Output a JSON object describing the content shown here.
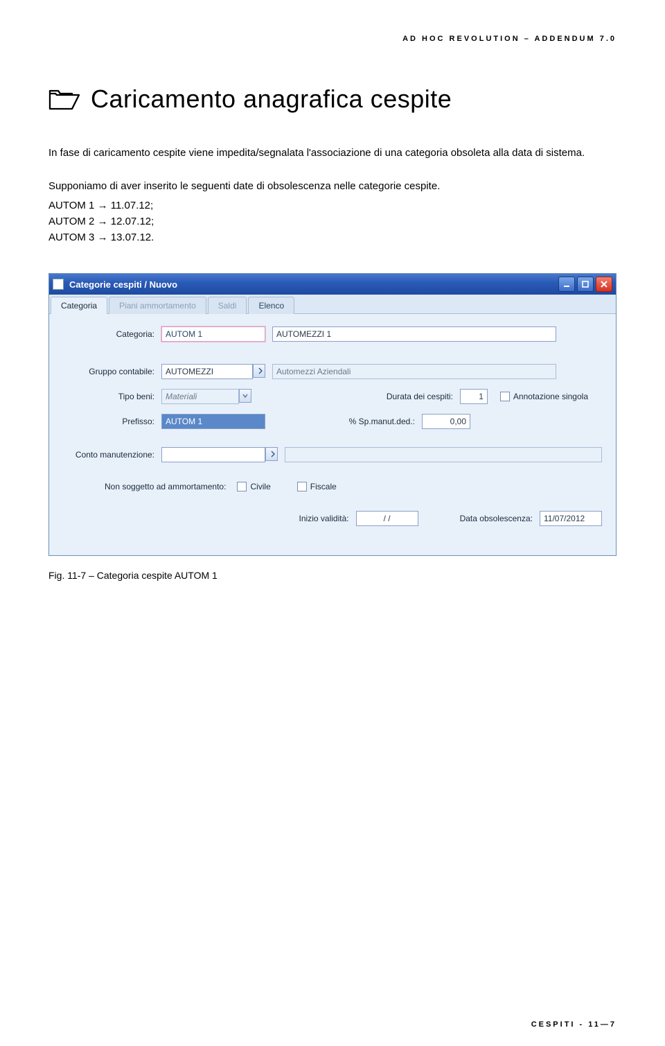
{
  "header": {
    "running": "AD HOC REVOLUTION – ADDENDUM 7.0"
  },
  "title": "Caricamento anagrafica cespite",
  "para1": "In fase di caricamento cespite viene impedita/segnalata l'associazione di una categoria obsoleta alla data di sistema.",
  "para2": "Supponiamo di aver inserito le seguenti date di obsolescenza nelle categorie cespite.",
  "list": {
    "a": "AUTOM 1 → 11.07.12;",
    "b": "AUTOM 2 → 12.07.12;",
    "c": "AUTOM 3 → 13.07.12."
  },
  "window": {
    "title": "Categorie cespiti / Nuovo",
    "tabs": {
      "t1": "Categoria",
      "t2": "Piani ammortamento",
      "t3": "Saldi",
      "t4": "Elenco"
    },
    "labels": {
      "categoria": "Categoria:",
      "gruppo": "Gruppo contabile:",
      "tipo": "Tipo beni:",
      "durata": "Durata dei cespiti:",
      "annot": "Annotazione singola",
      "prefisso": "Prefisso:",
      "pct": "% Sp.manut.ded.:",
      "conto": "Conto manutenzione:",
      "nonsogg": "Non soggetto ad ammortamento:",
      "civile": "Civile",
      "fiscale": "Fiscale",
      "inizio": "Inizio validità:",
      "dataobs": "Data obsolescenza:"
    },
    "values": {
      "categoria_code": "AUTOM 1",
      "categoria_desc": "AUTOMEZZI 1",
      "gruppo_code": "AUTOMEZZI",
      "gruppo_desc": "Automezzi Aziendali",
      "tipo": "Materiali",
      "durata": "1",
      "prefisso": "AUTOM 1",
      "pct": "0,00",
      "conto": "",
      "inizio": "  /  /",
      "dataobs": "11/07/2012"
    }
  },
  "caption": "Fig. 11-7 – Categoria cespite AUTOM 1",
  "footer": "CESPITI - 11—7"
}
